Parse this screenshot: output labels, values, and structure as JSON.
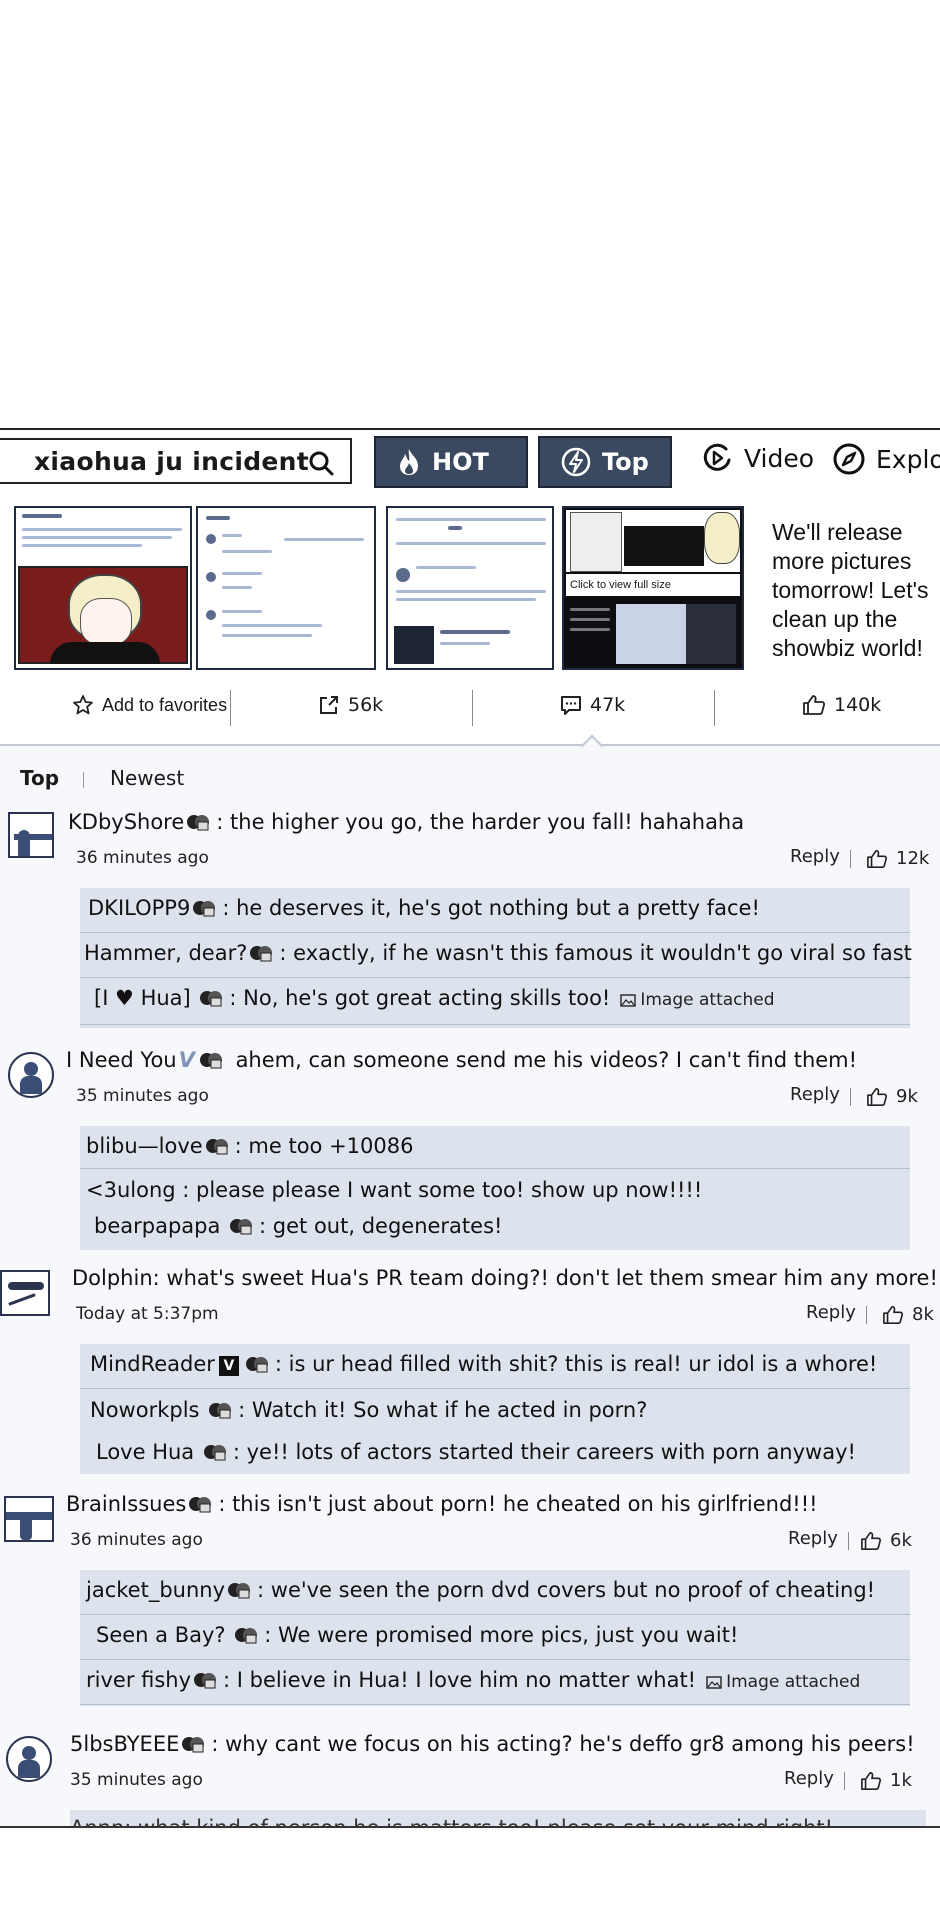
{
  "search": {
    "query": "xiaohua ju incident"
  },
  "tabs": {
    "hot": "HOT",
    "top": "Top"
  },
  "nav": {
    "video": "Video",
    "explore": "Explo"
  },
  "thumbs": {
    "full_size_label": "Click to view full size"
  },
  "promo_text": "We'll release more pictures tomorrow! Let's clean up the showbiz world!",
  "actions": {
    "favorites": "Add to favorites",
    "shares": "56k",
    "comments": "47k",
    "likes": "140k"
  },
  "sort": {
    "top": "Top",
    "newest": "Newest"
  },
  "comments": [
    {
      "user": "KDbyShore",
      "text": ": the higher you go, the harder you fall! hahahaha",
      "time": "36 minutes ago",
      "reply_label": "Reply",
      "likes": "12k",
      "replies": [
        {
          "user": "DKILOPP9",
          "text": ": he deserves it, he's got nothing but a pretty face!"
        },
        {
          "user": "Hammer, dear?",
          "text": ": exactly, if he wasn't this famous it wouldn't go viral so fast"
        },
        {
          "user": "[I ♥ Hua]",
          "text": ": No, he's got great acting skills too!",
          "attach": "Image attached"
        }
      ]
    },
    {
      "user": "I Need You",
      "badge": "V",
      "text": " ahem, can someone send me his videos? I can't find them!",
      "time": "35 minutes ago",
      "reply_label": "Reply",
      "likes": "9k",
      "replies": [
        {
          "user": "blibu—love",
          "text": ":  me too +10086"
        },
        {
          "user": "<3ulong",
          "text": " : please please I want some too! show up now!!!!"
        },
        {
          "user": "bearpapapa",
          "text": ":  get out, degenerates!"
        }
      ]
    },
    {
      "user": "Dolphin",
      "text": ": what's sweet Hua's PR team doing?! don't let them smear him any more!",
      "time": "Today at 5:37pm",
      "reply_label": "Reply",
      "likes": "8k",
      "replies": [
        {
          "user": "MindReader",
          "badge": "V",
          "text": ": is ur head filled with shit? this is real! ur idol is a whore!"
        },
        {
          "user": "Noworkpls",
          "text": ": Watch it! So what if he acted in porn?"
        },
        {
          "user": "Love Hua",
          "text": ":  ye!! lots of actors started their careers with porn anyway!"
        }
      ]
    },
    {
      "user": "BrainIssues",
      "text": ": this isn't just about porn! he cheated on his girlfriend!!!",
      "time": "36 minutes ago",
      "reply_label": "Reply",
      "likes": "6k",
      "replies": [
        {
          "user": "jacket_bunny",
          "text": ": we've seen the porn dvd covers but no proof of cheating!"
        },
        {
          "user": "Seen a Bay?",
          "text": ":  We were promised more pics, just you wait!"
        },
        {
          "user": "river fishy",
          "text": ": I believe in Hua! I love him no matter what!",
          "attach": "Image attached"
        }
      ]
    },
    {
      "user": "5lbsBYEEE",
      "text": ": why cant we focus on his acting? he's deffo gr8 among his peers!",
      "time": "35 minutes ago",
      "reply_label": "Reply",
      "likes": "1k"
    }
  ],
  "cut_off_reply": "Annn: what kind of person he is matters too! please set your mind right!"
}
